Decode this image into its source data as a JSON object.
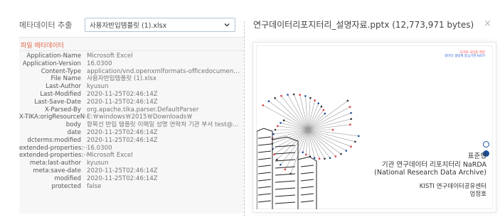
{
  "left_panel": {
    "extract_label": "메타데이터 추출",
    "select_value": "사용자반입템플릿 (1).xlsx",
    "section_title": "파일 메타데이터",
    "rows": [
      {
        "key": "Application-Name",
        "value": "Microsoft Excel"
      },
      {
        "key": "Application-Version",
        "value": "16.0300"
      },
      {
        "key": "Content-Type",
        "value": "application/vnd.openxmlformats-officedocument.sprea···"
      },
      {
        "key": "File Name",
        "value": "사용자반입템플릿 (1).xlsx"
      },
      {
        "key": "Last-Author",
        "value": "kyusun"
      },
      {
        "key": "Last-Modified",
        "value": "2020-11-25T02:46:14Z"
      },
      {
        "key": "Last-Save-Date",
        "value": "2020-11-25T02:46:14Z"
      },
      {
        "key": "X-Parsed-By",
        "value": "org.apache.tika.parser.DefaultParser"
      },
      {
        "key": "X-TIKA:origResourceN···",
        "value": "E:￦windows￦2015￦Downloads￦"
      },
      {
        "key": "body",
        "value": "항목선 반입 템플릿 이메일 성명 연락처 기관 부서 test@kigam.···"
      },
      {
        "key": "date",
        "value": "2020-11-25T02:46:14Z"
      },
      {
        "key": "dcterms:modified",
        "value": "2020-11-25T02:46:14Z"
      },
      {
        "key": "extended-properties:···",
        "value": "16.0300"
      },
      {
        "key": "extended-properties:···",
        "value": "Microsoft Excel"
      },
      {
        "key": "meta:last-author",
        "value": "kyusun"
      },
      {
        "key": "meta:save-date",
        "value": "2020-11-25T02:46:14Z"
      },
      {
        "key": "modified",
        "value": "2020-11-25T02:46:14Z"
      },
      {
        "key": "protected",
        "value": "false"
      }
    ]
  },
  "right_panel": {
    "file_title": "연구데이터리포지터리_설명자료.pptx (12,773,971 bytes)",
    "close_glyph": "×",
    "slide": {
      "tag_line1": "국가와 국민을 위한",
      "tag_line2": "데이터 생태계 중심기관 KISTI",
      "presenter": "표준형",
      "title_ko": "기관 연구데이터 리포지터리 NaRDA",
      "title_en": "(National Research Data Archive)",
      "org": "KISTI  연구데이터공유센터",
      "presenter2": "엄정호"
    }
  },
  "colors": {
    "accent_orange": "#e06a4a",
    "kisti_blue": "#1d4f99",
    "select_border": "#b5c3d8"
  }
}
